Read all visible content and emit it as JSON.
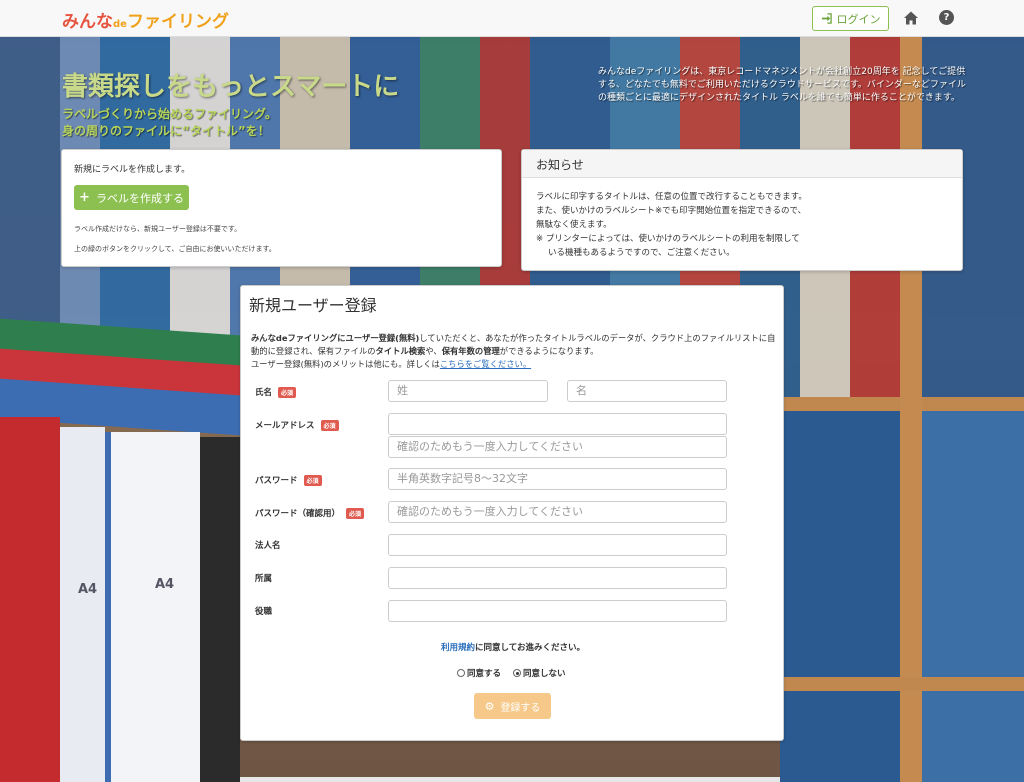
{
  "header": {
    "logo": {
      "part1": "みんな",
      "de": "de",
      "part2": "ファイリング"
    },
    "login_label": "ログイン",
    "icons": [
      "sign-in-icon",
      "home-icon",
      "question-icon"
    ]
  },
  "hero": {
    "title": "書類探しをもっとスマートに",
    "sub_line1": "ラベルづくりから始めるファイリング。",
    "sub_line2": "身の周りのファイルに“タイトル”を！",
    "description": "みんなdeファイリングは、東京レコードマネジメントが会社創立20周年を 記念してご提供する、どなたでも無料でご利用いただけるクラウドサービスです。バインダーなどファイルの種類ごとに最適にデザインされたタイトル ラベルを誰でも簡単に作ることができます。"
  },
  "label_panel": {
    "intro": "新規にラベルを作成します。",
    "button": "ラベルを作成する",
    "note1": "ラベル作成だけなら、新規ユーザー登録は不要です。",
    "note2": "上の緑のボタンをクリックして、ご自由にお使いいただけます。"
  },
  "notice": {
    "title": "お知らせ",
    "line1": "ラベルに印字するタイトルは、任意の位置で改行することもできます。",
    "line2": "また、使いかけのラベルシート※でも印字開始位置を指定できるので、",
    "line3": "無駄なく使えます。",
    "line4": "※ プリンターによっては、使いかけのラベルシートの利用を制限して",
    "line5": "いる機種もあるようですので、ご注意ください。"
  },
  "registration": {
    "title": "新規ユーザー登録",
    "intro_a": "みんなdeファイリングにユーザー登録(無料)",
    "intro_b": "していただくと、あなたが作ったタイトルラベルのデータが、クラウド上のファイルリストに自動的に登録され、保有ファイルの",
    "intro_c": "タイトル検索",
    "intro_d": "や、",
    "intro_e": "保有年数の管理",
    "intro_f": "ができるようになります。",
    "intro_g": "ユーザー登録(無料)のメリットは他にも。詳しくは",
    "intro_link": "こちらをご覧ください。",
    "required_badge": "必須",
    "fields": {
      "name_label": "氏名",
      "last_name_placeholder": "姓",
      "first_name_placeholder": "名",
      "email_label": "メールアドレス",
      "email_confirm_placeholder": "確認のためもう一度入力してください",
      "password_label": "パスワード",
      "password_placeholder": "半角英数字記号8～32文字",
      "password_confirm_label": "パスワード（確認用）",
      "password_confirm_placeholder": "確認のためもう一度入力してください",
      "company_label": "法人名",
      "department_label": "所属",
      "position_label": "役職"
    },
    "terms_link": "利用規約",
    "terms_text": "に同意してお進みください。",
    "agree_label": "同意する",
    "disagree_label": "同意しない",
    "selected": "disagree",
    "submit_label": "登録する"
  }
}
